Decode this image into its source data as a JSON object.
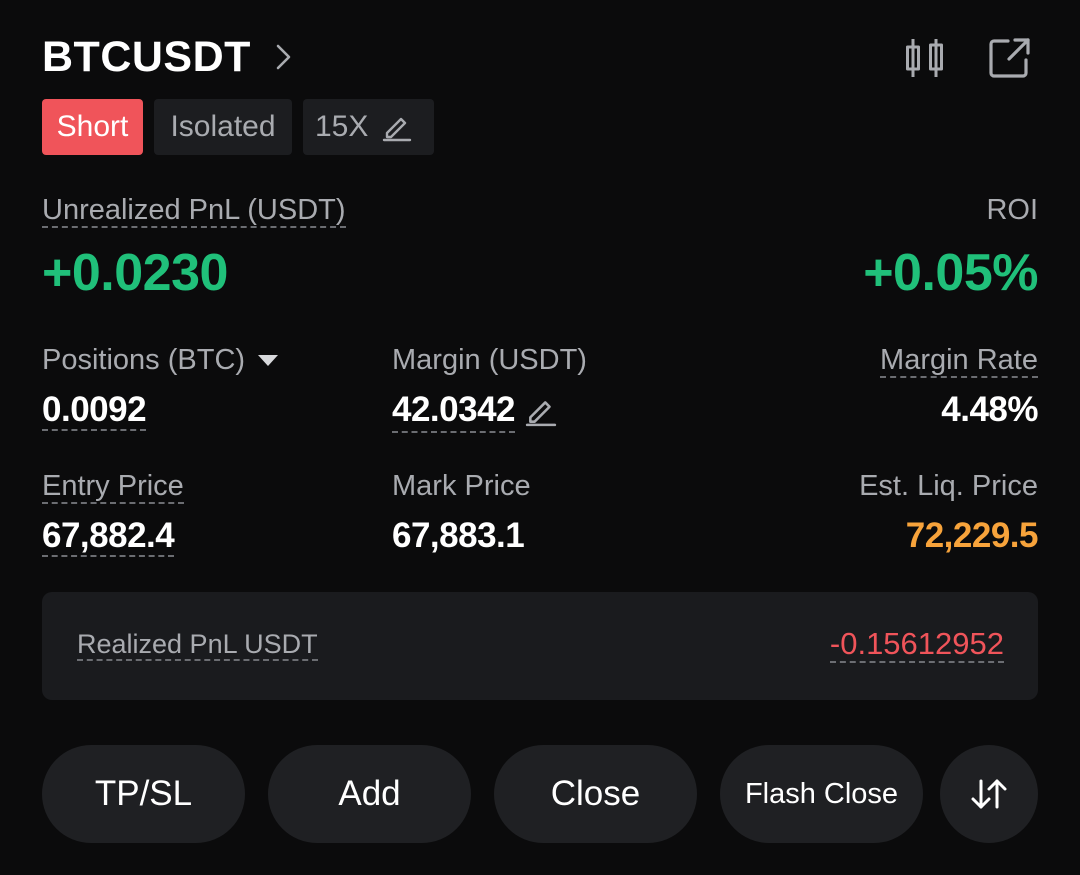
{
  "header": {
    "symbol": "BTCUSDT",
    "icons": [
      "candlestick-chart-icon",
      "share-icon"
    ]
  },
  "tags": {
    "side": "Short",
    "margin_mode": "Isolated",
    "leverage": "15X"
  },
  "pnl": {
    "unrealized_label": "Unrealized PnL (USDT)",
    "unrealized_value": "+0.0230",
    "roi_label": "ROI",
    "roi_value": "+0.05%"
  },
  "stats": {
    "positions_label": "Positions (BTC)",
    "positions_value": "0.0092",
    "margin_label": "Margin (USDT)",
    "margin_value": "42.0342",
    "margin_rate_label": "Margin Rate",
    "margin_rate_value": "4.48%",
    "entry_label": "Entry Price",
    "entry_value": "67,882.4",
    "mark_label": "Mark Price",
    "mark_value": "67,883.1",
    "liq_label": "Est. Liq. Price",
    "liq_value": "72,229.5"
  },
  "realized": {
    "label": "Realized PnL USDT",
    "value": "-0.15612952"
  },
  "actions": {
    "tpsl": "TP/SL",
    "add": "Add",
    "close": "Close",
    "flash_close": "Flash Close",
    "reverse_icon": "reverse-arrows-icon"
  },
  "colors": {
    "green": "#20c07a",
    "red": "#f0545a",
    "orange": "#f7a33b",
    "background": "#0b0b0c"
  }
}
